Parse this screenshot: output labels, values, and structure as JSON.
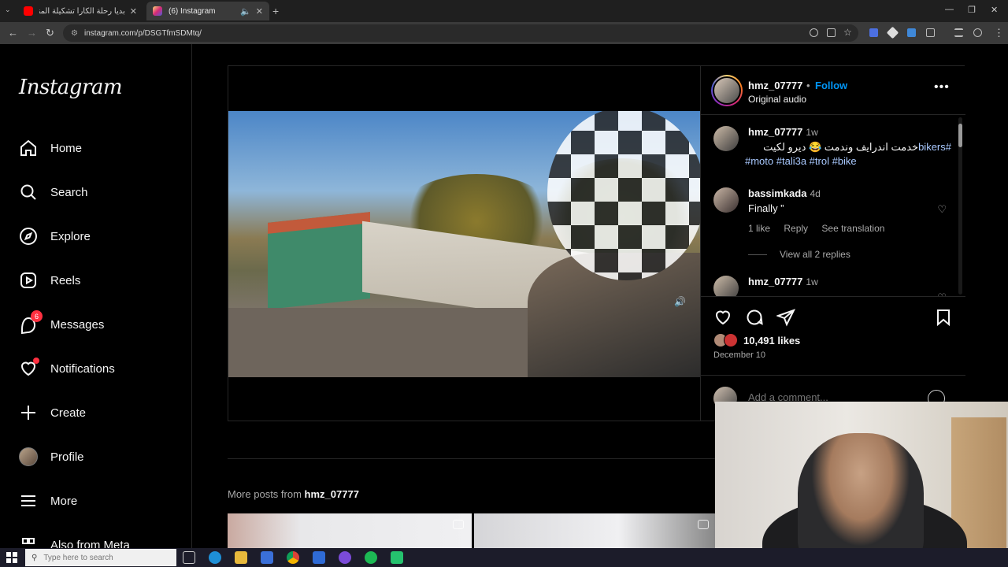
{
  "browser": {
    "tabs": [
      {
        "title": "بديا رحلة الكارا تشكيلة المنتخب",
        "favicon_color": "#ff0000",
        "active": false
      },
      {
        "title": "(6) Instagram",
        "favicon_color": "#e1306c",
        "active": true
      }
    ],
    "url": "instagram.com/p/DSGTfmSDMtq/"
  },
  "sidebar": {
    "logo": "Instagram",
    "items": [
      {
        "label": "Home",
        "icon": "home-icon"
      },
      {
        "label": "Search",
        "icon": "search-icon"
      },
      {
        "label": "Explore",
        "icon": "compass-icon"
      },
      {
        "label": "Reels",
        "icon": "reels-icon"
      },
      {
        "label": "Messages",
        "icon": "messenger-icon",
        "badge": "6"
      },
      {
        "label": "Notifications",
        "icon": "heart-icon"
      },
      {
        "label": "Create",
        "icon": "plus-icon"
      },
      {
        "label": "Profile",
        "icon": "avatar"
      },
      {
        "label": "More",
        "icon": "menu-icon"
      },
      {
        "label": "Also from Meta",
        "icon": "meta-icon"
      }
    ]
  },
  "post": {
    "username": "hmz_07777",
    "separator": "•",
    "follow_label": "Follow",
    "audio": "Original audio",
    "caption": {
      "time": "1w",
      "text": "خدمت اندرايف وندمت 😂 ديرو لكيت",
      "tags_inline": "#bikers",
      "tags": "#moto #tali3a #trol #bike"
    },
    "comments": [
      {
        "user": "bassimkada",
        "time": "4d",
        "text": "Finally ”",
        "likes": "1 like",
        "reply": "Reply",
        "translate": "See translation",
        "view_replies": "View all 2 replies"
      },
      {
        "user": "hmz_07777",
        "time": "1w",
        "text": "..."
      }
    ],
    "likes_count": "10,491 likes",
    "date": "December 10",
    "add_comment_placeholder": "Add a comment..."
  },
  "more_posts": {
    "prefix": "More posts from",
    "user": "hmz_07777"
  },
  "taskbar": {
    "search_placeholder": "Type here to search"
  }
}
